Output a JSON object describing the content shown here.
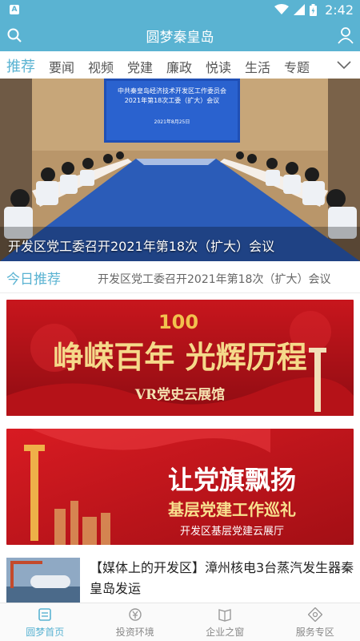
{
  "status_bar": {
    "time": "2:42",
    "notification_glyph": "A"
  },
  "header": {
    "title": "圆梦秦皇岛"
  },
  "tabs": [
    {
      "label": "推荐",
      "active": true
    },
    {
      "label": "要闻"
    },
    {
      "label": "视频"
    },
    {
      "label": "党建"
    },
    {
      "label": "廉政"
    },
    {
      "label": "悦读"
    },
    {
      "label": "生活"
    },
    {
      "label": "专题"
    }
  ],
  "hero": {
    "caption": "开发区党工委召开2021年第18次（扩大）会议",
    "screen_line1": "中共秦皇岛经济技术开发区工作委员会",
    "screen_line2": "2021年第18次工委（扩大）会议",
    "screen_date": "2021年8月25日"
  },
  "today": {
    "label": "今日推荐",
    "news": "开发区党工委召开2021年第18次（扩大）会议"
  },
  "banner1": {
    "line1": "峥嵘百年 光辉历程",
    "line2": "VR党史云展馆",
    "badge": "100"
  },
  "banner2": {
    "line1": "让党旗飘扬",
    "line2": "基层党建工作巡礼",
    "line3": "开发区基层党建云展厅"
  },
  "news_item": {
    "headline": "【媒体上的开发区】漳州核电3台蒸汽发生器秦皇岛发运"
  },
  "bottom_nav": [
    {
      "label": "圆梦首页",
      "active": true
    },
    {
      "label": "投资环境"
    },
    {
      "label": "企业之窗"
    },
    {
      "label": "服务专区"
    }
  ],
  "colors": {
    "accent": "#5ab3d2",
    "party_red": "#c8161d",
    "gold": "#f2c14e"
  }
}
